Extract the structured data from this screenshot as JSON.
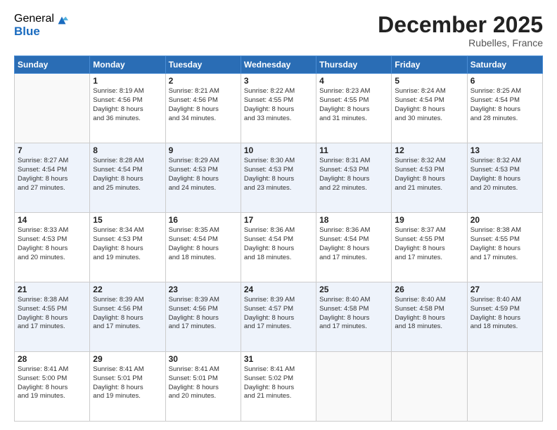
{
  "header": {
    "logo_general": "General",
    "logo_blue": "Blue",
    "month_title": "December 2025",
    "location": "Rubelles, France"
  },
  "days_of_week": [
    "Sunday",
    "Monday",
    "Tuesday",
    "Wednesday",
    "Thursday",
    "Friday",
    "Saturday"
  ],
  "weeks": [
    [
      {
        "day": "",
        "info": ""
      },
      {
        "day": "1",
        "info": "Sunrise: 8:19 AM\nSunset: 4:56 PM\nDaylight: 8 hours\nand 36 minutes."
      },
      {
        "day": "2",
        "info": "Sunrise: 8:21 AM\nSunset: 4:56 PM\nDaylight: 8 hours\nand 34 minutes."
      },
      {
        "day": "3",
        "info": "Sunrise: 8:22 AM\nSunset: 4:55 PM\nDaylight: 8 hours\nand 33 minutes."
      },
      {
        "day": "4",
        "info": "Sunrise: 8:23 AM\nSunset: 4:55 PM\nDaylight: 8 hours\nand 31 minutes."
      },
      {
        "day": "5",
        "info": "Sunrise: 8:24 AM\nSunset: 4:54 PM\nDaylight: 8 hours\nand 30 minutes."
      },
      {
        "day": "6",
        "info": "Sunrise: 8:25 AM\nSunset: 4:54 PM\nDaylight: 8 hours\nand 28 minutes."
      }
    ],
    [
      {
        "day": "7",
        "info": "Sunrise: 8:27 AM\nSunset: 4:54 PM\nDaylight: 8 hours\nand 27 minutes."
      },
      {
        "day": "8",
        "info": "Sunrise: 8:28 AM\nSunset: 4:54 PM\nDaylight: 8 hours\nand 25 minutes."
      },
      {
        "day": "9",
        "info": "Sunrise: 8:29 AM\nSunset: 4:53 PM\nDaylight: 8 hours\nand 24 minutes."
      },
      {
        "day": "10",
        "info": "Sunrise: 8:30 AM\nSunset: 4:53 PM\nDaylight: 8 hours\nand 23 minutes."
      },
      {
        "day": "11",
        "info": "Sunrise: 8:31 AM\nSunset: 4:53 PM\nDaylight: 8 hours\nand 22 minutes."
      },
      {
        "day": "12",
        "info": "Sunrise: 8:32 AM\nSunset: 4:53 PM\nDaylight: 8 hours\nand 21 minutes."
      },
      {
        "day": "13",
        "info": "Sunrise: 8:32 AM\nSunset: 4:53 PM\nDaylight: 8 hours\nand 20 minutes."
      }
    ],
    [
      {
        "day": "14",
        "info": "Sunrise: 8:33 AM\nSunset: 4:53 PM\nDaylight: 8 hours\nand 20 minutes."
      },
      {
        "day": "15",
        "info": "Sunrise: 8:34 AM\nSunset: 4:53 PM\nDaylight: 8 hours\nand 19 minutes."
      },
      {
        "day": "16",
        "info": "Sunrise: 8:35 AM\nSunset: 4:54 PM\nDaylight: 8 hours\nand 18 minutes."
      },
      {
        "day": "17",
        "info": "Sunrise: 8:36 AM\nSunset: 4:54 PM\nDaylight: 8 hours\nand 18 minutes."
      },
      {
        "day": "18",
        "info": "Sunrise: 8:36 AM\nSunset: 4:54 PM\nDaylight: 8 hours\nand 17 minutes."
      },
      {
        "day": "19",
        "info": "Sunrise: 8:37 AM\nSunset: 4:55 PM\nDaylight: 8 hours\nand 17 minutes."
      },
      {
        "day": "20",
        "info": "Sunrise: 8:38 AM\nSunset: 4:55 PM\nDaylight: 8 hours\nand 17 minutes."
      }
    ],
    [
      {
        "day": "21",
        "info": "Sunrise: 8:38 AM\nSunset: 4:55 PM\nDaylight: 8 hours\nand 17 minutes."
      },
      {
        "day": "22",
        "info": "Sunrise: 8:39 AM\nSunset: 4:56 PM\nDaylight: 8 hours\nand 17 minutes."
      },
      {
        "day": "23",
        "info": "Sunrise: 8:39 AM\nSunset: 4:56 PM\nDaylight: 8 hours\nand 17 minutes."
      },
      {
        "day": "24",
        "info": "Sunrise: 8:39 AM\nSunset: 4:57 PM\nDaylight: 8 hours\nand 17 minutes."
      },
      {
        "day": "25",
        "info": "Sunrise: 8:40 AM\nSunset: 4:58 PM\nDaylight: 8 hours\nand 17 minutes."
      },
      {
        "day": "26",
        "info": "Sunrise: 8:40 AM\nSunset: 4:58 PM\nDaylight: 8 hours\nand 18 minutes."
      },
      {
        "day": "27",
        "info": "Sunrise: 8:40 AM\nSunset: 4:59 PM\nDaylight: 8 hours\nand 18 minutes."
      }
    ],
    [
      {
        "day": "28",
        "info": "Sunrise: 8:41 AM\nSunset: 5:00 PM\nDaylight: 8 hours\nand 19 minutes."
      },
      {
        "day": "29",
        "info": "Sunrise: 8:41 AM\nSunset: 5:01 PM\nDaylight: 8 hours\nand 19 minutes."
      },
      {
        "day": "30",
        "info": "Sunrise: 8:41 AM\nSunset: 5:01 PM\nDaylight: 8 hours\nand 20 minutes."
      },
      {
        "day": "31",
        "info": "Sunrise: 8:41 AM\nSunset: 5:02 PM\nDaylight: 8 hours\nand 21 minutes."
      },
      {
        "day": "",
        "info": ""
      },
      {
        "day": "",
        "info": ""
      },
      {
        "day": "",
        "info": ""
      }
    ]
  ]
}
